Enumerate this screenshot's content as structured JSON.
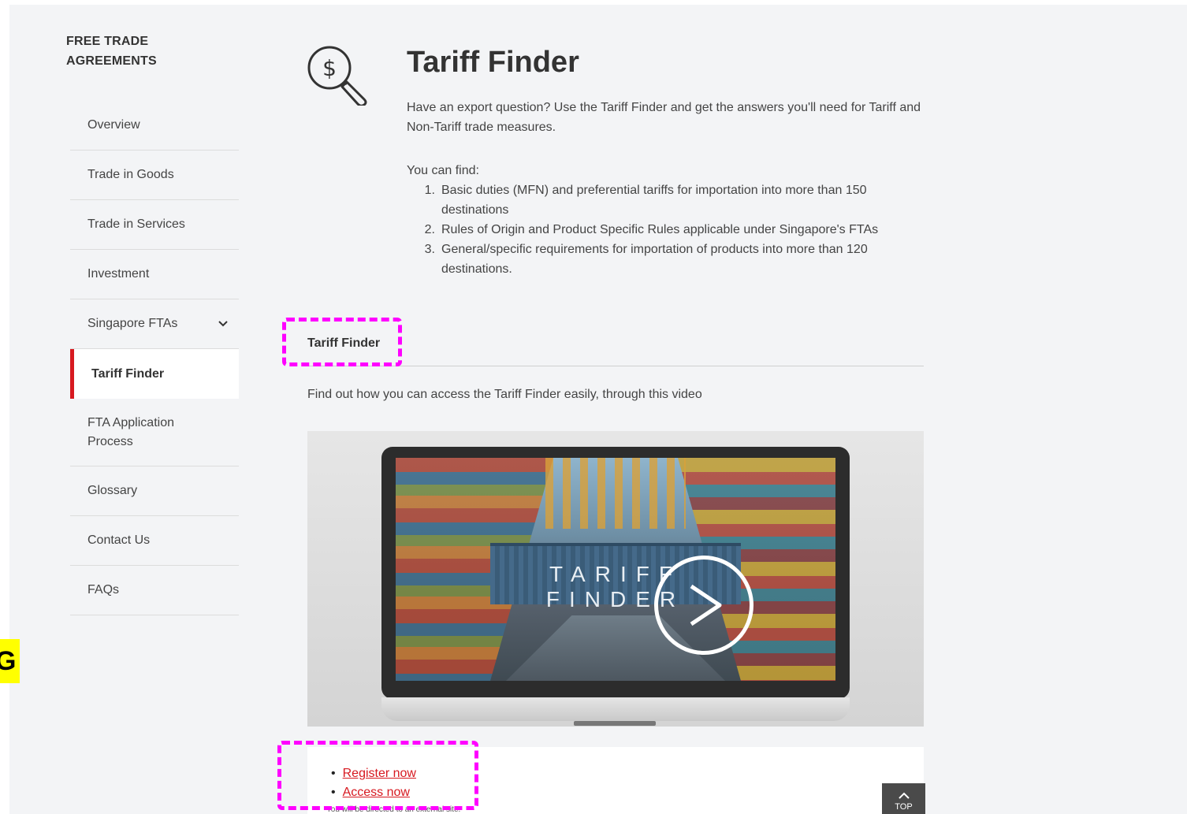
{
  "sidebar": {
    "heading": "FREE TRADE AGREEMENTS",
    "items": [
      {
        "label": "Overview"
      },
      {
        "label": "Trade in Goods"
      },
      {
        "label": "Trade in Services"
      },
      {
        "label": "Investment"
      },
      {
        "label": "Singapore FTAs",
        "expandable": true
      },
      {
        "label": "Tariff Finder",
        "active": true
      },
      {
        "label": "FTA Application Process"
      },
      {
        "label": "Glossary"
      },
      {
        "label": "Contact Us"
      },
      {
        "label": "FAQs"
      }
    ]
  },
  "edge_marker": "G",
  "main": {
    "icon": "dollar-magnifier-icon",
    "title": "Tariff Finder",
    "intro": "Have an export question? Use the Tariff Finder and get the answers you'll need for Tariff and Non-Tariff trade measures.",
    "find_label": "You can find:",
    "find_items": [
      "Basic duties (MFN) and preferential tariffs for importation into more than 150 destinations",
      "Rules of Origin and Product Specific Rules applicable under Singapore's FTAs",
      "General/specific requirements for importation of products into more than 120 destinations."
    ],
    "section_title": "Tariff Finder",
    "video_intro": "Find out how you can access the Tariff Finder easily, through this video",
    "video": {
      "overlay_text": "TARIFF FINDER",
      "play_icon": "play-icon"
    },
    "links": [
      {
        "label": "Register now"
      },
      {
        "label": "Access now"
      }
    ],
    "external_note": "You will be directed to an external site."
  },
  "top_button": {
    "label": "TOP",
    "icon": "chevron-up-icon"
  },
  "colors": {
    "accent": "#d71920",
    "background": "#f3f4f6",
    "highlight": "#ff00ff",
    "marker": "#ffff00"
  }
}
